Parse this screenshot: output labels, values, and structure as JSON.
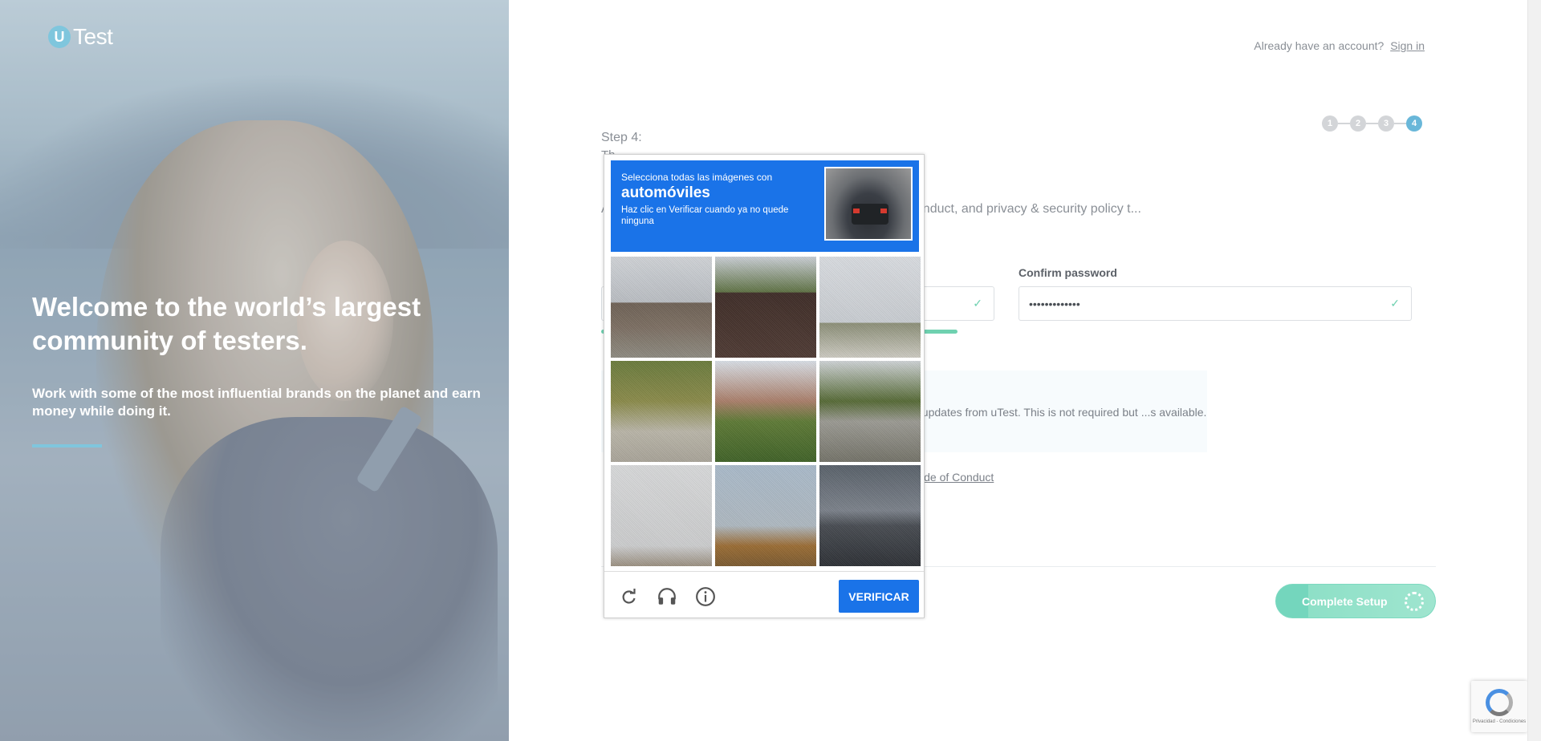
{
  "brand": {
    "logo_mark": "U",
    "logo_text": "Test"
  },
  "hero": {
    "title": "Welcome to the world’s largest community of testers.",
    "subtitle": "Work with some of the most influential brands on the planet and earn money while doing it."
  },
  "header": {
    "already_text": "Already have an account?",
    "signin_label": "Sign in"
  },
  "steps": {
    "items": [
      "1",
      "2",
      "3",
      "4"
    ],
    "active": "4",
    "label": "Step 4:",
    "title": "Th..."
  },
  "form": {
    "intro_text": "A... Then review and accept our terms of use, code of conduct, and privacy & security policy t...",
    "password_value": "••••••••••••••",
    "confirm_label": "Confirm password",
    "confirm_value": "•••••••••••••",
    "newsletter_text": "...s and updates from uTest. This is not required but ...s available.",
    "coc_link": "...est Code of Conduct",
    "complete_label": "Complete Setup"
  },
  "captcha": {
    "line1": "Selecciona todas las imágenes con",
    "keyword": "automóviles",
    "line3": "Haz clic en Verificar cuando ya no quede ninguna",
    "verify_label": "VERIFICAR",
    "icons": [
      "reload-icon",
      "audio-icon",
      "info-icon"
    ]
  },
  "recaptcha_badge": {
    "text": "Privacidad - Condiciones"
  },
  "colors": {
    "accent": "#69b7d9",
    "success": "#6fd1b0",
    "captcha_blue": "#1a73e8"
  }
}
